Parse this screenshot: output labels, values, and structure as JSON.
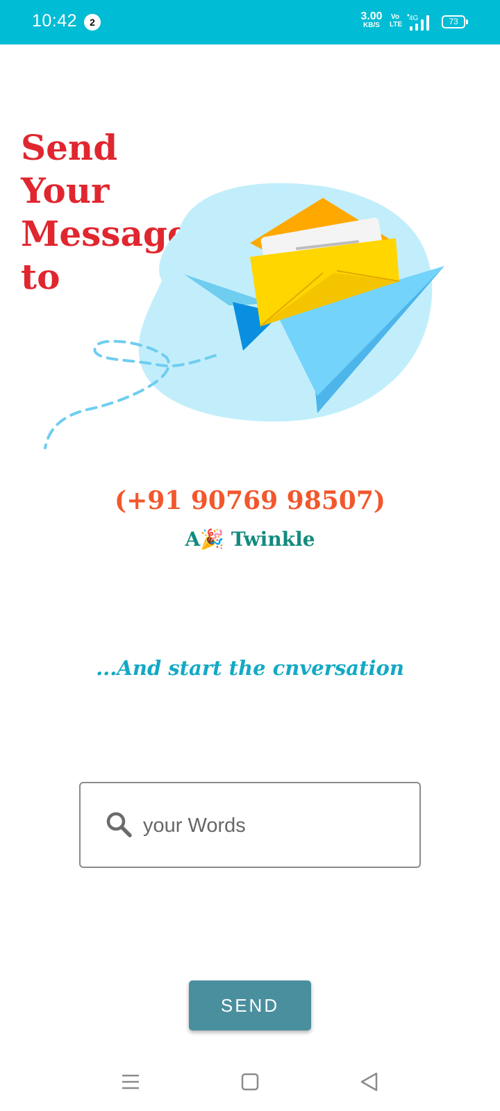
{
  "status_bar": {
    "time": "10:42",
    "notification_count": "2",
    "net_speed_value": "3.00",
    "net_speed_unit": "KB/S",
    "volte_top": "Vo",
    "volte_bottom": "LTE",
    "network_type": "4G",
    "battery_level": "73",
    "background_color": "#00BCD4"
  },
  "headline": {
    "line1": "Send",
    "line2": "Your",
    "line3": "Message",
    "line4": "to",
    "color": "#E0262F"
  },
  "recipient": {
    "phone": "(+91 90769 98507)",
    "name_prefix": "A",
    "name_emoji": "🎉",
    "name_suffix": "Twinkle"
  },
  "tagline": "...And start the cnversation",
  "message_input": {
    "placeholder": "your Words",
    "value": ""
  },
  "send_button": {
    "label": "SEND",
    "color": "#4A8F9E"
  },
  "icons": {
    "search": "search-icon",
    "illustration": "paper-plane-envelope-illustration",
    "nav_menu": "menu-icon",
    "nav_home": "home-icon",
    "nav_back": "back-icon"
  }
}
